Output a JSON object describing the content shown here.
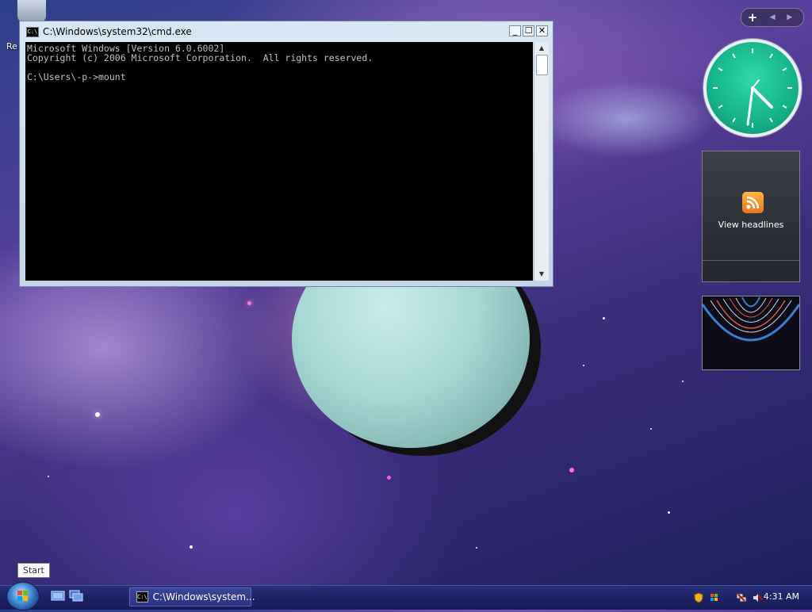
{
  "desktop": {
    "icon_label_partial": "Re"
  },
  "cmd_window": {
    "title": "C:\\Windows\\system32\\cmd.exe",
    "title_icon_text": "C:\\",
    "buttons": {
      "minimize": "_",
      "maximize": "☐",
      "close": "✕"
    },
    "console_lines": [
      "Microsoft Windows [Version 6.0.6002]",
      "Copyright (c) 2006 Microsoft Corporation.  All rights reserved.",
      "",
      "C:\\Users\\-p->mount"
    ]
  },
  "sidebar": {
    "add_label": "+",
    "nav_label": "◀ ▶",
    "feed_gadget": {
      "label": "View headlines"
    }
  },
  "clock_gadget": {
    "time_shown": "4:31"
  },
  "taskbar": {
    "start_tooltip": "Start",
    "task_button_label": "C:\\Windows\\system...",
    "clock_time": "4:31 AM"
  },
  "colors": {
    "taskbar": "#1d2266",
    "clock_face": "#15b28a",
    "rss": "#f08a24"
  }
}
